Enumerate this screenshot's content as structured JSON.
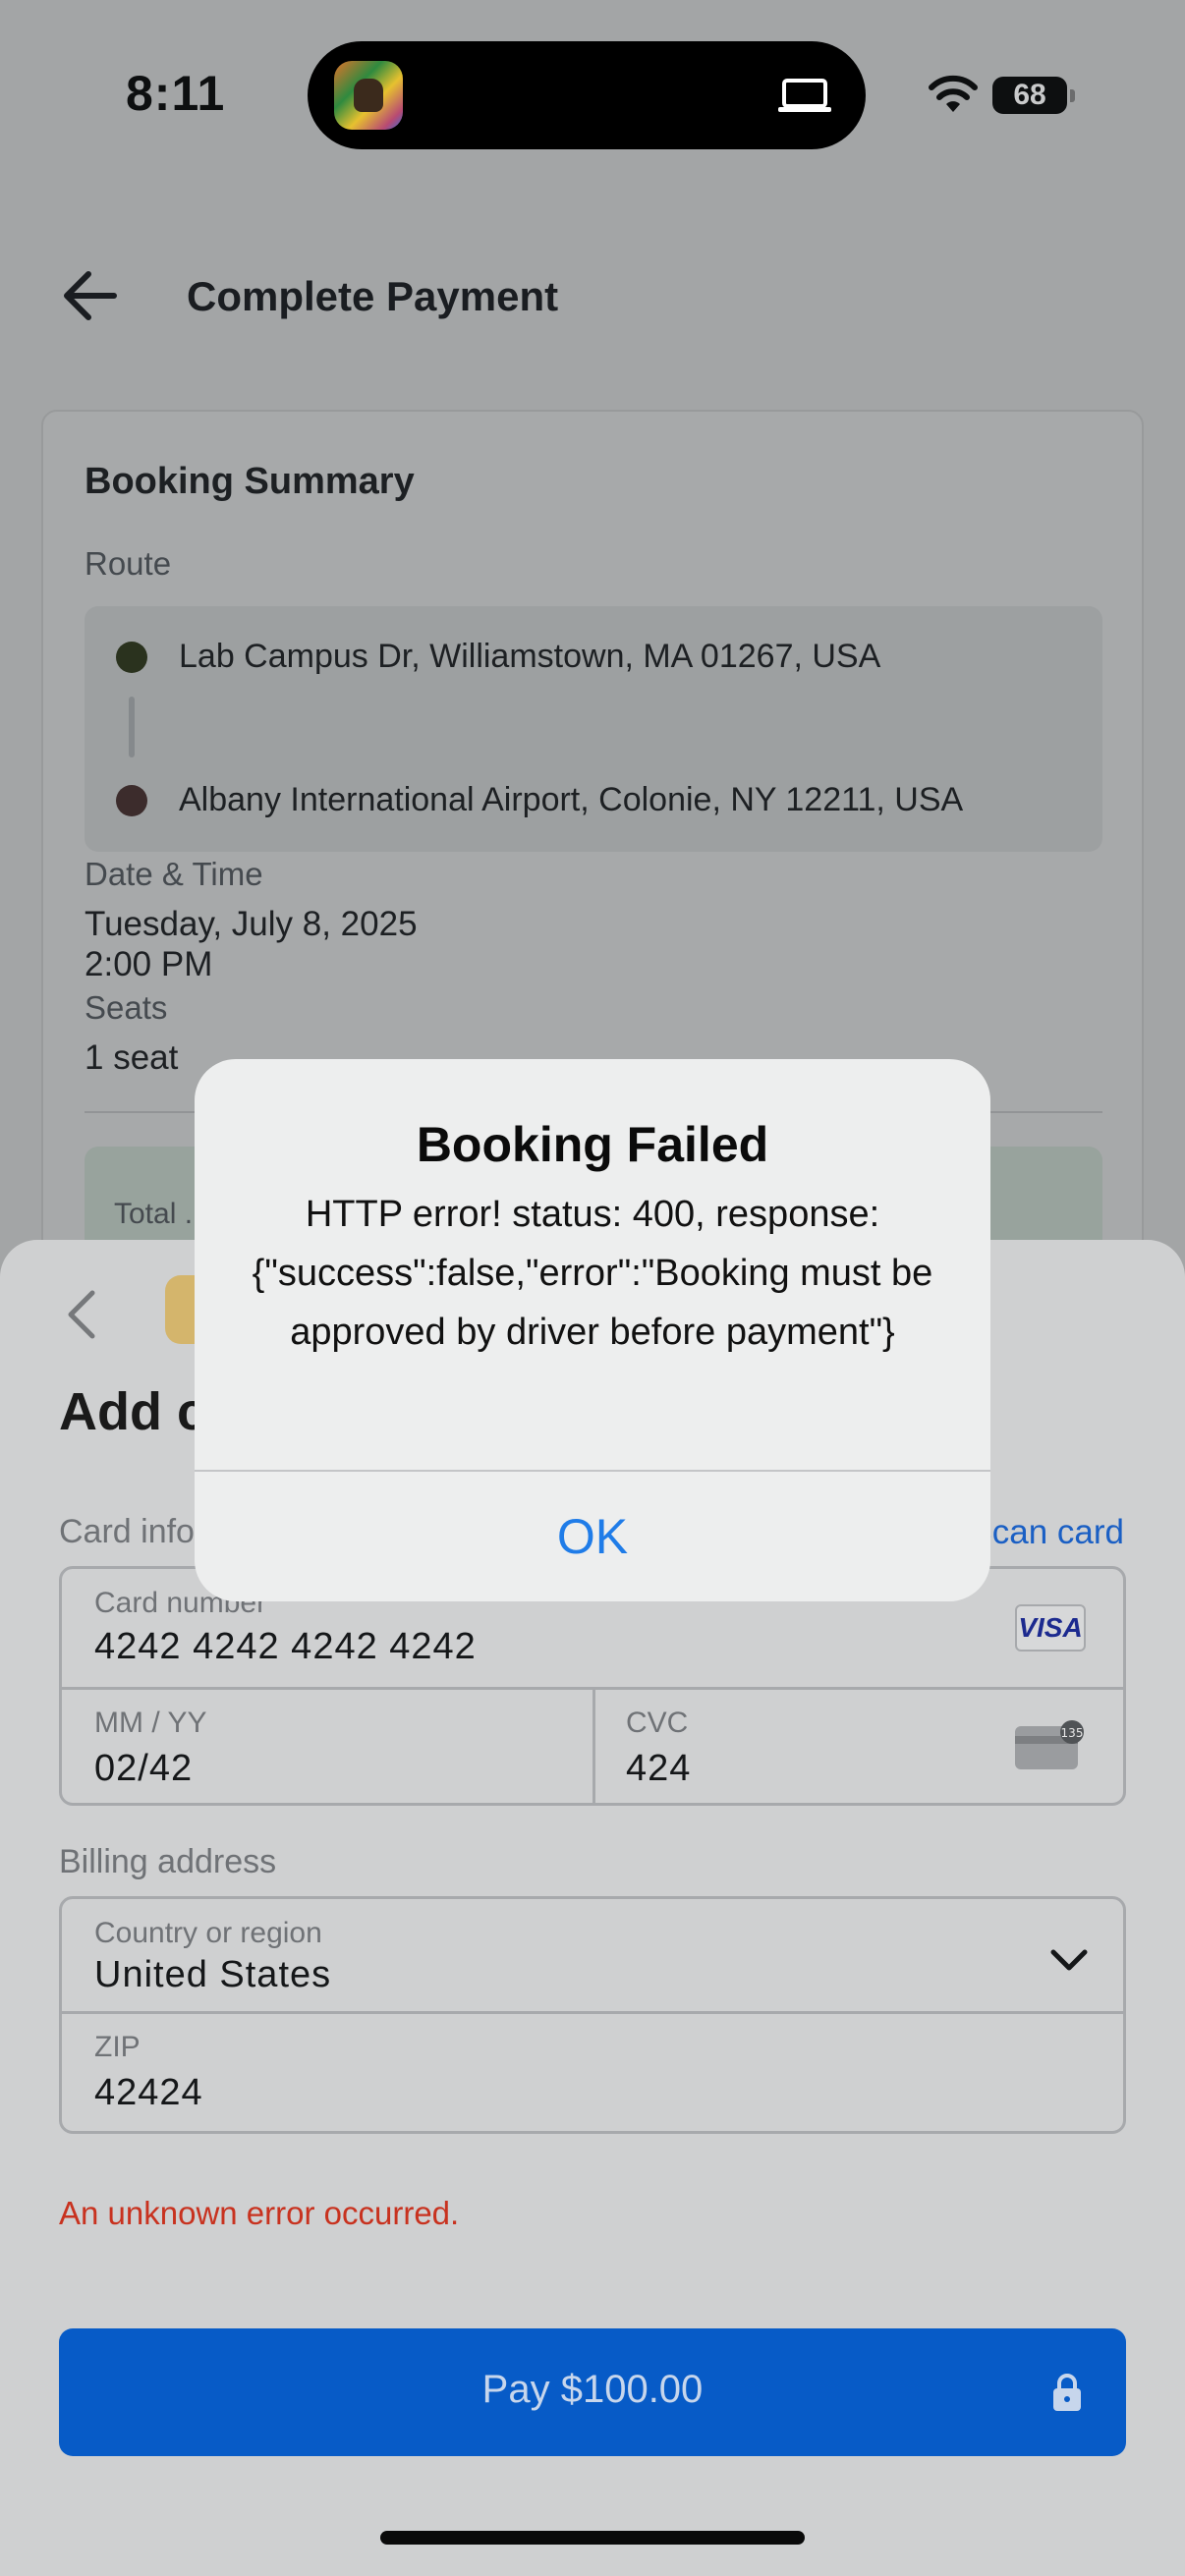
{
  "status_bar": {
    "time": "8:11",
    "battery": "68"
  },
  "header": {
    "title": "Complete Payment"
  },
  "booking": {
    "title": "Booking Summary",
    "route_label": "Route",
    "origin": "Lab Campus Dr, Williamstown, MA 01267, USA",
    "destination": "Albany International Airport, Colonie, NY 12211, USA",
    "datetime_label": "Date & Time",
    "date": "Tuesday, July 8, 2025",
    "time": "2:00 PM",
    "seats_label": "Seats",
    "seats": "1 seat",
    "total_label": "Total ...",
    "origin_color": "#2a321e",
    "destination_color": "#3c2c2c"
  },
  "sheet": {
    "title": "Add card",
    "card_info_label": "Card information",
    "scan_card": "Scan card",
    "card_number_label": "Card number",
    "card_number": "4242 4242 4242 4242",
    "card_brand": "VISA",
    "expiry_label": "MM / YY",
    "expiry": "02/42",
    "cvc_label": "CVC",
    "cvc": "424",
    "cvc_badge": "135",
    "billing_label": "Billing address",
    "country_label": "Country or region",
    "country": "United States",
    "zip_label": "ZIP",
    "zip": "42424",
    "error": "An unknown error occurred.",
    "pay_button": "Pay $100.00"
  },
  "alert": {
    "title": "Booking Failed",
    "message": "HTTP error! status: 400, response: {\"success\":false,\"error\":\"Booking must be approved by driver before payment\"}",
    "ok": "OK"
  },
  "colors": {
    "primary": "#075bc7",
    "link": "#1f7ce8",
    "error": "#c8321f"
  }
}
